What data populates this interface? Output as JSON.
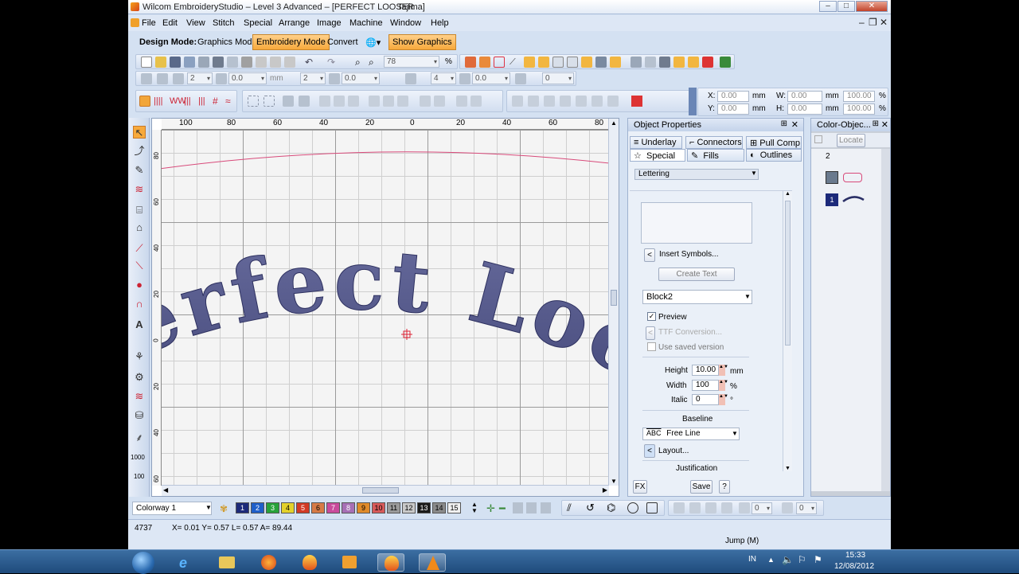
{
  "window": {
    "title": "Wilcom EmbroideryStudio – Level 3 Advanced – [PERFECT LOOSER",
    "machine": "Tajima]",
    "controls": [
      "–",
      "□",
      "✕"
    ],
    "mdi_controls": [
      "–",
      "❐",
      "✕"
    ]
  },
  "menu": [
    "File",
    "Edit",
    "View",
    "Stitch",
    "Special",
    "Arrange",
    "Image",
    "Machine",
    "Window",
    "Help"
  ],
  "modebar": {
    "label": "Design Mode:",
    "graphics_mode": "Graphics Mode",
    "embroidery_mode": "Embroidery Mode",
    "convert": "Convert",
    "show_graphics": "Show Graphics"
  },
  "toolbar": {
    "zoom": "78",
    "zoom_unit": "%",
    "row2_values": [
      "2",
      "0.0",
      "mm",
      "2",
      "0.0",
      "4",
      "0.0",
      "0"
    ],
    "pos_x_label": "X:",
    "pos_x": "0.00",
    "pos_y_label": "Y:",
    "pos_y": "0.00",
    "size_w_label": "W:",
    "size_w": "0.00",
    "size_h_label": "H:",
    "size_h": "0.00",
    "unit_mm": "mm",
    "pct_w": "100.00",
    "pct_h": "100.00",
    "pct": "%"
  },
  "ruler": {
    "top": [
      "100",
      "80",
      "60",
      "40",
      "20",
      "0",
      "20",
      "40",
      "60",
      "80"
    ],
    "left": [
      "80",
      "60",
      "40",
      "20",
      "0",
      "20",
      "40",
      "60"
    ],
    "left_tool_labels": [
      "1000",
      "100"
    ]
  },
  "canvas": {
    "text": "Perfect Loose"
  },
  "object_properties": {
    "title": "Object Properties",
    "tabs_row1": [
      "Underlay",
      "Connectors",
      "Pull Comp"
    ],
    "tabs_row2": [
      "Special",
      "Fills",
      "Outlines"
    ],
    "dropdown": "Lettering",
    "insert_symbols": "Insert Symbols...",
    "create_text": "Create Text",
    "font": "Block2",
    "preview": "Preview",
    "ttf_conversion": "TTF Conversion...",
    "use_saved": "Use saved version",
    "height_label": "Height",
    "height": "10.00",
    "height_unit": "mm",
    "width_label": "Width",
    "width": "100",
    "width_unit": "%",
    "italic_label": "Italic",
    "italic": "0",
    "italic_unit": "°",
    "baseline_label": "Baseline",
    "baseline_icon": "ABC",
    "baseline": "Free Line",
    "layout": "Layout...",
    "justification": "Justification",
    "fx": "FX",
    "save": "Save",
    "help": "?"
  },
  "color_object": {
    "title": "Color-Objec...",
    "locate": "Locate",
    "group": "2",
    "item": "1"
  },
  "colorbar": {
    "colorway": "Colorway 1",
    "swatches": [
      {
        "n": "1",
        "c": "#1c2a7a",
        "t": "#ffffff"
      },
      {
        "n": "2",
        "c": "#1f5fc9",
        "t": "#ffffff"
      },
      {
        "n": "3",
        "c": "#27a23a",
        "t": "#ffffff"
      },
      {
        "n": "4",
        "c": "#e3d12c",
        "t": "#000000"
      },
      {
        "n": "5",
        "c": "#d23a25",
        "t": "#ffffff"
      },
      {
        "n": "6",
        "c": "#d77a46",
        "t": "#000000"
      },
      {
        "n": "7",
        "c": "#c94a9c",
        "t": "#ffffff"
      },
      {
        "n": "8",
        "c": "#a76fb5",
        "t": "#ffffff"
      },
      {
        "n": "9",
        "c": "#df8a2a",
        "t": "#000000"
      },
      {
        "n": "10",
        "c": "#d85a5a",
        "t": "#000000"
      },
      {
        "n": "11",
        "c": "#9a9a9a",
        "t": "#000000"
      },
      {
        "n": "12",
        "c": "#c9c9c9",
        "t": "#000000"
      },
      {
        "n": "13",
        "c": "#1a1a1a",
        "t": "#ffffff"
      },
      {
        "n": "14",
        "c": "#8a8a8a",
        "t": "#000000"
      },
      {
        "n": "15",
        "c": "#f0f0f0",
        "t": "#000000"
      }
    ],
    "spin_values": [
      "0",
      "0"
    ]
  },
  "status": {
    "stitches": "4737",
    "coords": "X= 0.01 Y= 0.57 L= 0.57 A= 89.44",
    "jump": "Jump (M)"
  },
  "taskbar": {
    "lang": "IN",
    "time": "15:33",
    "date": "12/08/2012"
  },
  "colors": {
    "accent": "#f7a93c",
    "thread": "#5a5e8c",
    "taskbar": "#2a5a8e"
  }
}
